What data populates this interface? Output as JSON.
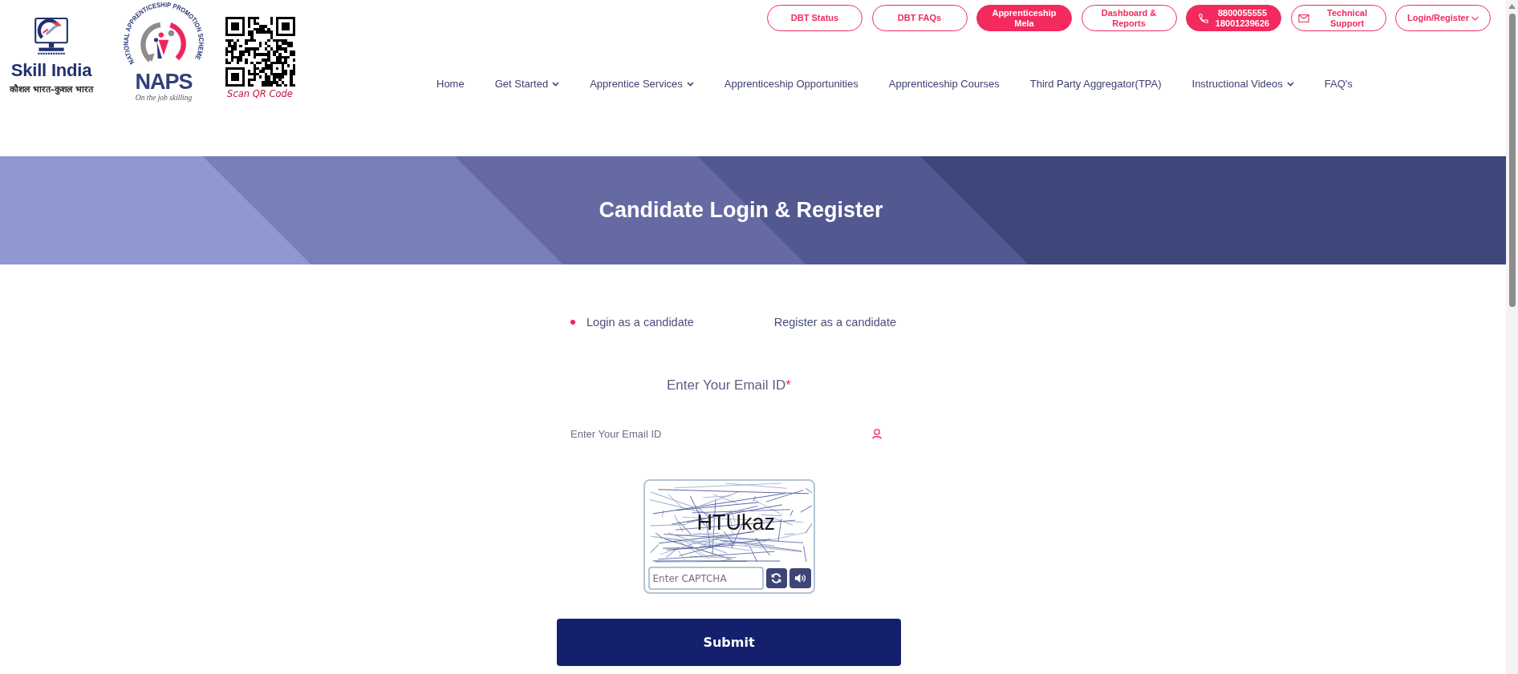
{
  "header": {
    "skill_logo": {
      "title": "Skill India",
      "tagline": "कौशल भारत-कुशल भारत"
    },
    "naps_logo": {
      "arc_text": "NATIONAL APPRENTICESHIP PROMOTION SCHEME",
      "title": "NAPS",
      "tagline": "On the job skilling"
    },
    "qr_code": {
      "caption": "Scan QR Code"
    },
    "top_buttons": [
      {
        "label": "DBT Status",
        "kind": "plain",
        "highlighted": false
      },
      {
        "label": "DBT FAQs",
        "kind": "plain",
        "highlighted": false
      },
      {
        "label": "Apprenticeship Mela",
        "kind": "plain",
        "highlighted": true
      },
      {
        "label": "Dashboard & Reports",
        "kind": "plain",
        "highlighted": false
      },
      {
        "label": "8800055555 18001239626",
        "kind": "phone",
        "highlighted": true
      },
      {
        "label": "Technical Support",
        "kind": "mail",
        "highlighted": false
      },
      {
        "label": "Login/Register",
        "kind": "dropdown",
        "highlighted": false
      }
    ],
    "nav": [
      {
        "label": "Home",
        "dropdown": false
      },
      {
        "label": "Get Started",
        "dropdown": true
      },
      {
        "label": "Apprentice Services",
        "dropdown": true
      },
      {
        "label": "Apprenticeship Opportunities",
        "dropdown": false
      },
      {
        "label": "Apprenticeship Courses",
        "dropdown": false
      },
      {
        "label": "Third Party Aggregator(TPA)",
        "dropdown": false
      },
      {
        "label": "Instructional Videos",
        "dropdown": true
      },
      {
        "label": "FAQ's",
        "dropdown": false
      }
    ]
  },
  "banner": {
    "title": "Candidate Login & Register"
  },
  "login_form": {
    "tabs": [
      {
        "label": "Login as a candidate",
        "selected": true
      },
      {
        "label": "Register as a candidate",
        "selected": false
      }
    ],
    "email": {
      "label": "Enter Your Email ID",
      "required_mark": "*",
      "placeholder": "Enter Your Email ID"
    },
    "captcha": {
      "code": "HTUkaz",
      "placeholder": "Enter CAPTCHA"
    },
    "submit": "Submit"
  }
}
